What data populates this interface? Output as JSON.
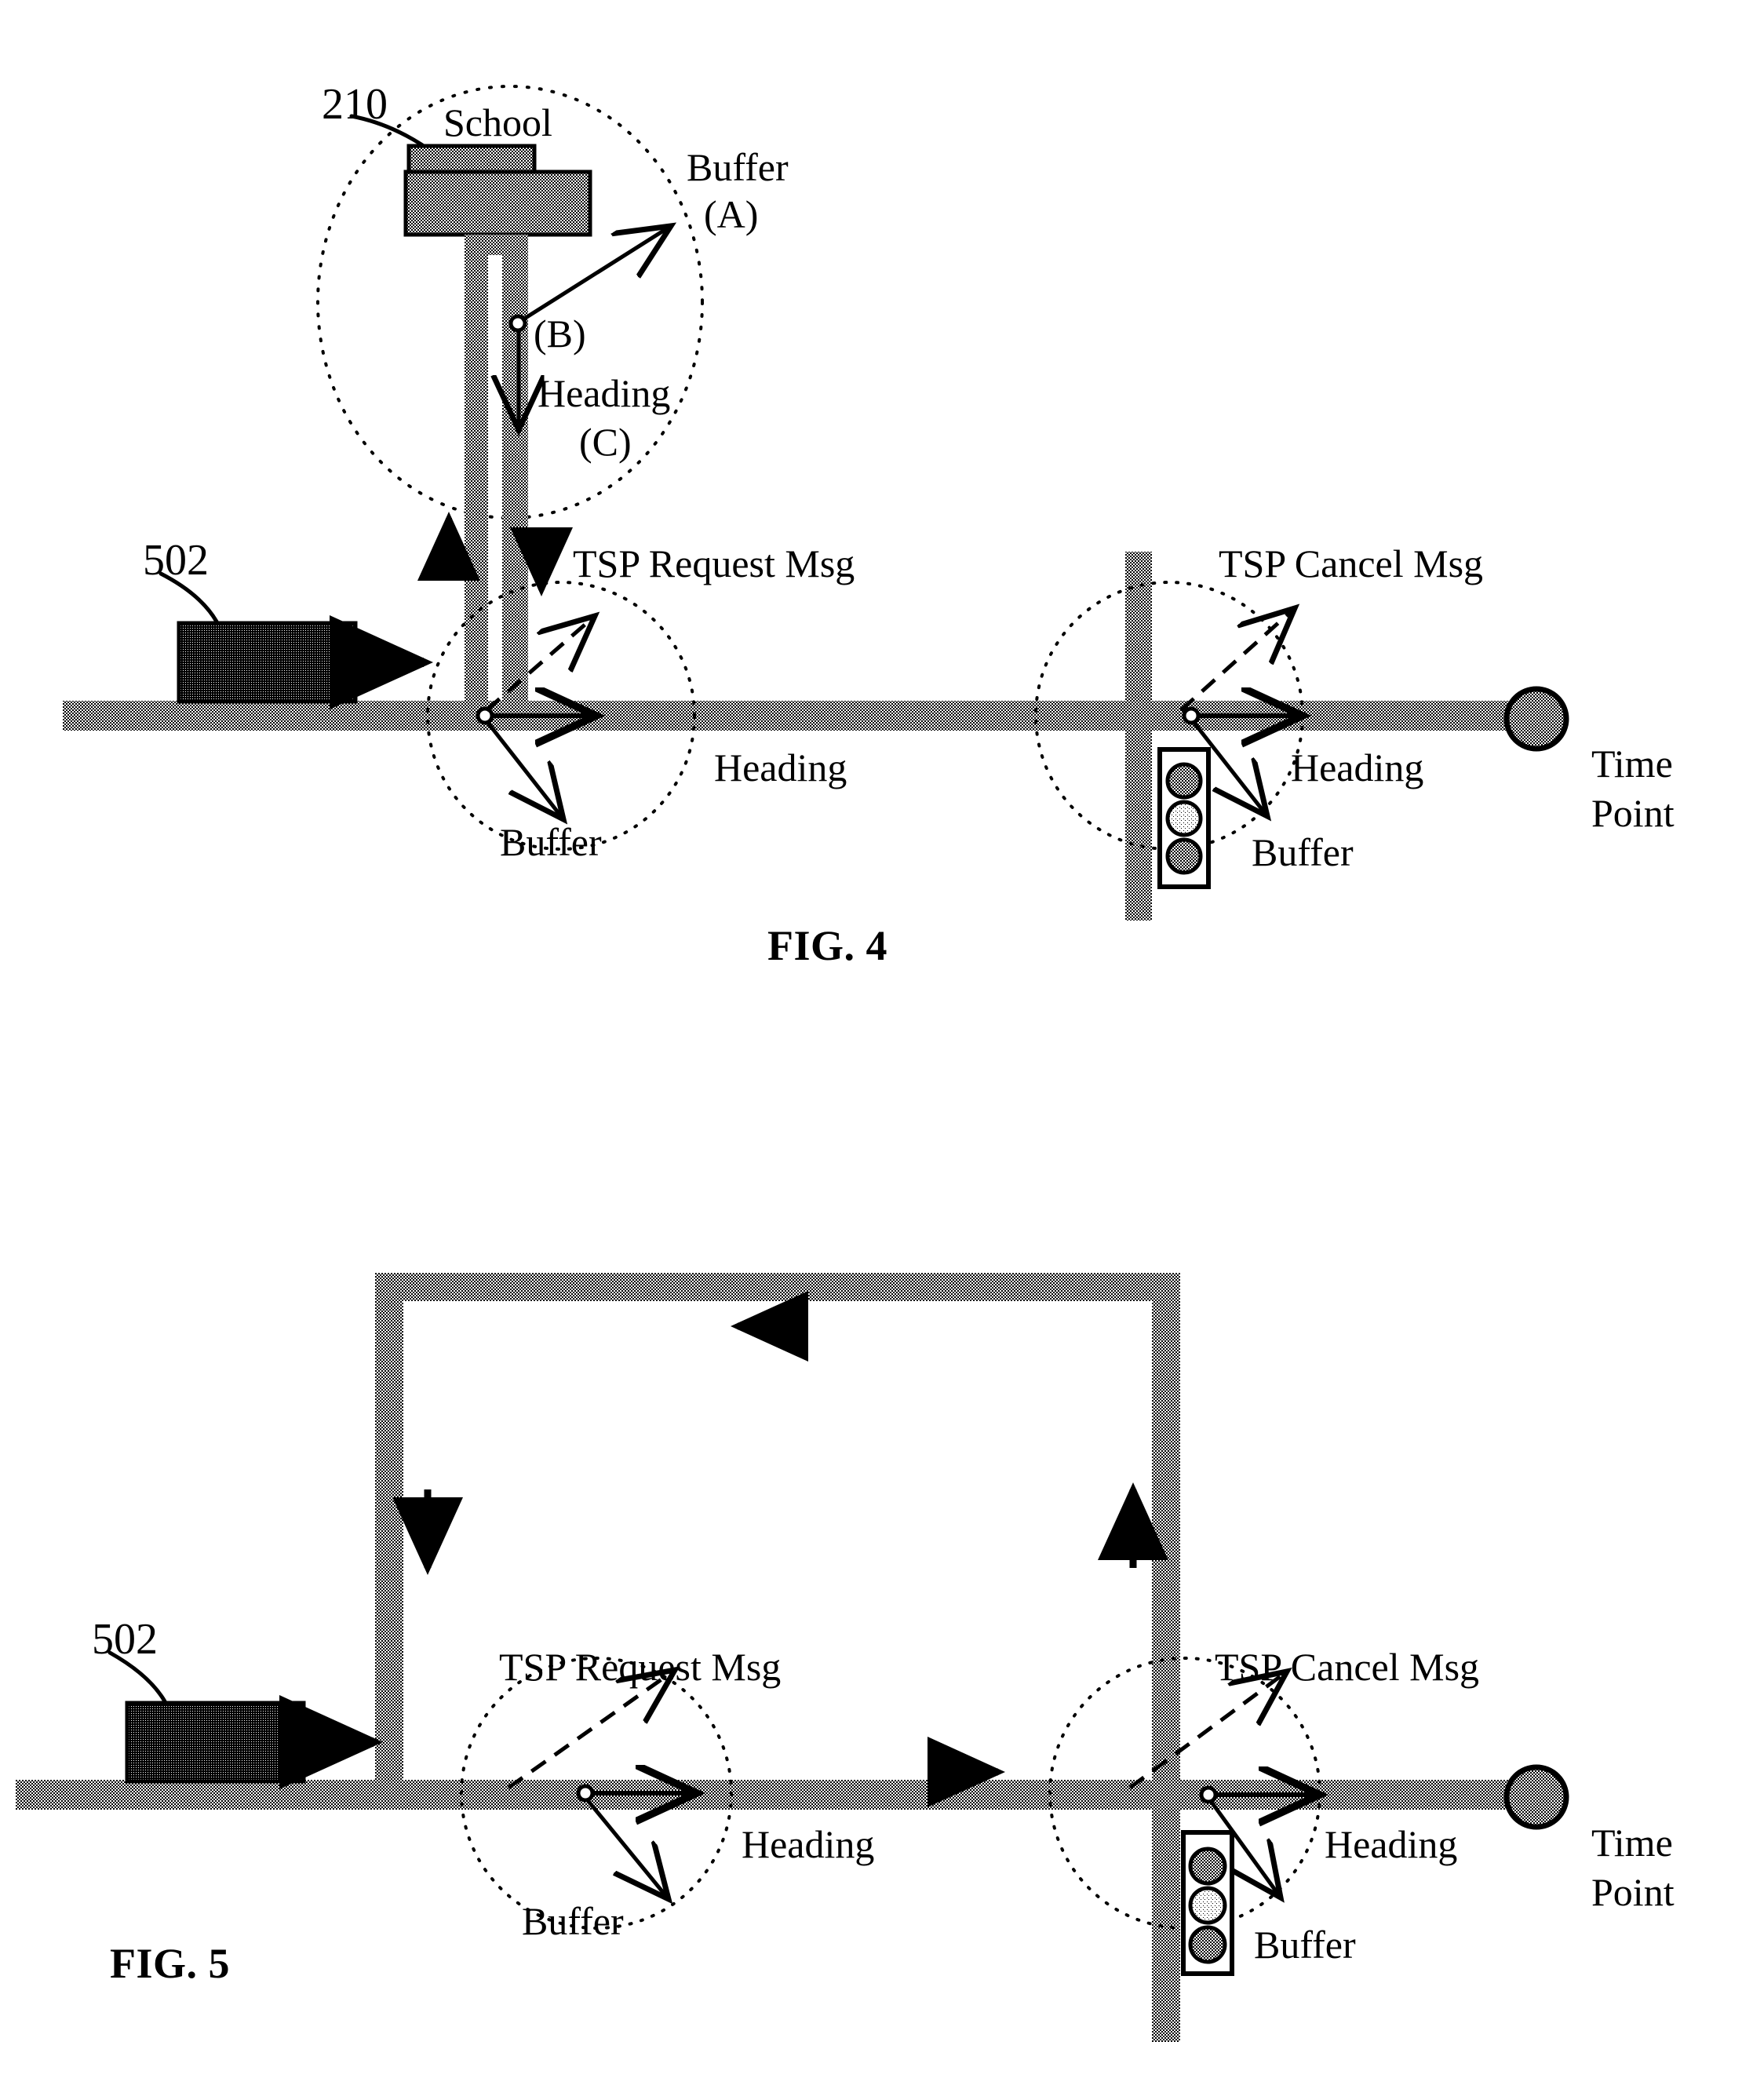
{
  "document": {
    "type": "patent-drawing-sheet",
    "background_color": "#ffffff",
    "ink_color": "#000000",
    "road_fill": "#8a8a8a",
    "building_fill": "#7a7a7a",
    "vehicle_fill": "#3a3a3a"
  },
  "figures": [
    {
      "id": "fig4",
      "caption": "FIG. 4",
      "reference_numerals": [
        {
          "id": "ref-210",
          "text": "210"
        },
        {
          "id": "ref-502",
          "text": "502"
        }
      ],
      "labels": {
        "school": "School",
        "buffer_a": "Buffer",
        "buffer_a_sub": "(A)",
        "heading_b": "(B)",
        "heading_c_text": "Heading",
        "heading_c_sub": "(C)",
        "tsp_request": "TSP Request Msg",
        "tsp_cancel": "TSP Cancel Msg",
        "heading_left": "Heading",
        "buffer_left": "Buffer",
        "heading_right": "Heading",
        "buffer_right": "Buffer",
        "time_point_line1": "Time",
        "time_point_line2": "Point"
      },
      "elements": {
        "school_building": "school-building",
        "school_roof": "school-roof",
        "vehicle": "transit-vehicle-502",
        "traffic_signal": "traffic-signal-head",
        "time_point_marker": "time-point-marker",
        "buffer_circle_school": "buffer-zone-circle-school",
        "buffer_circle_request": "buffer-zone-circle-request",
        "buffer_circle_cancel": "buffer-zone-circle-cancel"
      },
      "signal_lamps": [
        {
          "name": "red-lamp",
          "state": "dark"
        },
        {
          "name": "yellow-lamp",
          "state": "lit"
        },
        {
          "name": "green-lamp",
          "state": "dark"
        }
      ]
    },
    {
      "id": "fig5",
      "caption": "FIG. 5",
      "reference_numerals": [
        {
          "id": "ref-502",
          "text": "502"
        }
      ],
      "labels": {
        "tsp_request": "TSP Request Msg",
        "tsp_cancel": "TSP Cancel Msg",
        "heading_left": "Heading",
        "buffer_left": "Buffer",
        "heading_right": "Heading",
        "buffer_right": "Buffer",
        "time_point_line1": "Time",
        "time_point_line2": "Point"
      },
      "elements": {
        "vehicle": "transit-vehicle-502",
        "traffic_signal": "traffic-signal-head",
        "time_point_marker": "time-point-marker",
        "detour_loop": "detour-route-loop",
        "buffer_circle_request": "buffer-zone-circle-request",
        "buffer_circle_cancel": "buffer-zone-circle-cancel"
      },
      "signal_lamps": [
        {
          "name": "red-lamp",
          "state": "dark"
        },
        {
          "name": "yellow-lamp",
          "state": "lit"
        },
        {
          "name": "green-lamp",
          "state": "dark"
        }
      ]
    }
  ]
}
